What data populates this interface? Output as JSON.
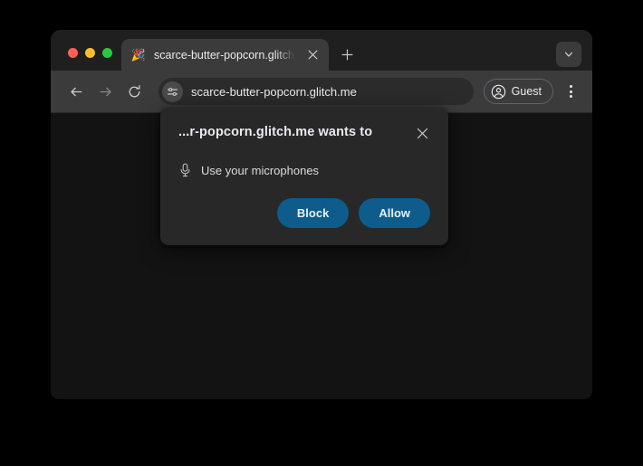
{
  "window": {
    "traffic_lights": [
      {
        "name": "close",
        "color": "#ff5f57"
      },
      {
        "name": "minimize",
        "color": "#febc2e"
      },
      {
        "name": "maximize",
        "color": "#28c840"
      }
    ]
  },
  "tab_strip": {
    "tab": {
      "favicon": "🎉",
      "favicon_name": "party-popper-favicon",
      "title": "scarce-butter-popcorn.glitch.",
      "close_icon": "close-icon"
    },
    "new_tab_label": "+",
    "new_tab_icon": "plus-icon",
    "tab_search_icon": "chevron-down-icon"
  },
  "toolbar": {
    "back_icon": "arrow-left-icon",
    "forward_icon": "arrow-right-icon",
    "reload_icon": "reload-icon",
    "omnibox": {
      "site_settings_icon": "tune-icon",
      "url": "scarce-butter-popcorn.glitch.me"
    },
    "profile": {
      "icon": "account-circle-icon",
      "label": "Guest"
    },
    "menu_icon": "more-vertical-icon"
  },
  "permission_dialog": {
    "title": "...r-popcorn.glitch.me wants to",
    "close_icon": "close-icon",
    "permission_icon": "microphone-icon",
    "permission_label": "Use your microphones",
    "block_label": "Block",
    "allow_label": "Allow",
    "button_color": "#0d5c8c"
  },
  "colors": {
    "desktop_background": "#000000",
    "tab_strip": "#1f1f1f",
    "toolbar": "#3b3b3b",
    "viewport": "#131313",
    "dialog": "#282828"
  }
}
